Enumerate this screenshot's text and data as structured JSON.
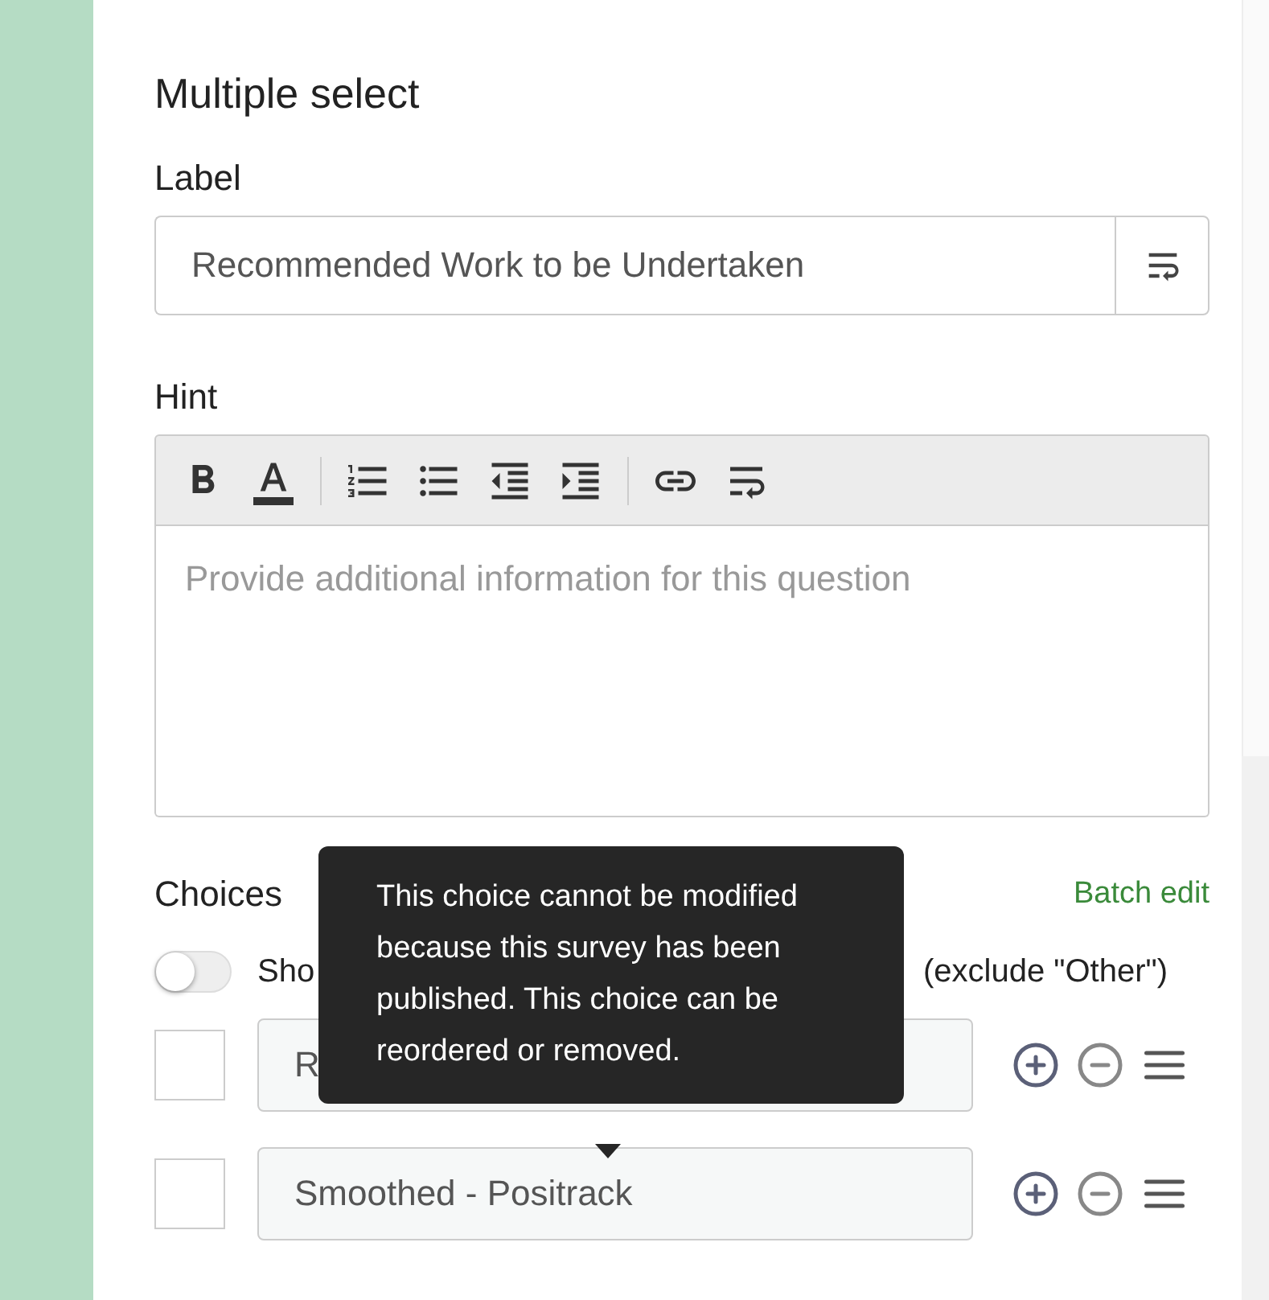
{
  "panel": {
    "title": "Multiple select"
  },
  "label_field": {
    "label": "Label",
    "value": "Recommended Work to be Undertaken"
  },
  "hint_field": {
    "label": "Hint",
    "placeholder": "Provide additional information for this question"
  },
  "choices": {
    "heading": "Choices",
    "batch_edit": "Batch edit",
    "random_order": {
      "label_parts": [
        "Sho",
        "(exclude \"Other\")"
      ],
      "on": false
    },
    "items": [
      {
        "value": "R",
        "checked": false
      },
      {
        "value": "Smoothed - Positrack",
        "checked": false
      }
    ]
  },
  "tooltip": {
    "text": "This choice cannot be modified because this survey has been published. This choice can be reordered or removed."
  }
}
